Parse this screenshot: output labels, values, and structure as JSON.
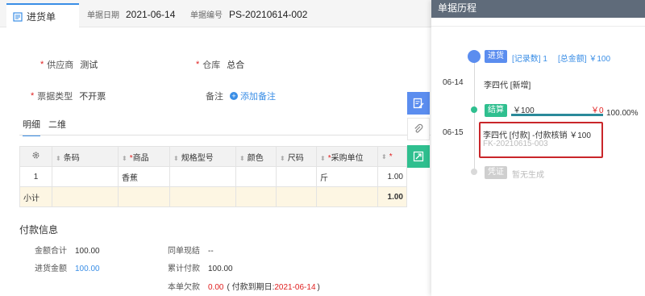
{
  "header": {
    "tab_label": "进货单",
    "date_label": "单据日期",
    "date_value": "2021-06-14",
    "number_label": "单据编号",
    "number_value": "PS-20210614-002"
  },
  "form": {
    "supplier_label": "供应商",
    "supplier_value": "测试",
    "warehouse_label": "仓库",
    "warehouse_value": "总合",
    "invoice_type_label": "票据类型",
    "invoice_type_value": "不开票",
    "note_label": "备注",
    "add_note_label": "添加备注"
  },
  "subtabs": [
    "明细",
    "二维"
  ],
  "table": {
    "headers": [
      "条码",
      "商品",
      "规格型号",
      "颜色",
      "尺码",
      "采购单位"
    ],
    "row": {
      "index": "1",
      "product": "香蕉",
      "unit": "斤",
      "qty": "1.00"
    },
    "subtotal_label": "小计",
    "subtotal_value": "1.00"
  },
  "payment": {
    "title": "付款信息",
    "total_label": "金额合计",
    "total_value": "100.00",
    "purchase_label": "进货金额",
    "purchase_value": "100.00",
    "settle_label": "同单现结",
    "settle_value": "--",
    "paid_label": "累计付款",
    "paid_value": "100.00",
    "owed_label": "本单欠款",
    "owed_value": "0.00",
    "due_open": "( 付款到期日:",
    "due_date": "2021-06-14",
    "due_close": ")"
  },
  "history": {
    "title": "单据历程",
    "tag_purchase": "进货",
    "record_count": "[记录数] 1",
    "total_amount": "[总金额] ￥100",
    "date1": "06-14",
    "entry1": "李四代 [新增]",
    "tag_settle": "结算",
    "settle_amount": "￥100",
    "settle_remaining": "￥0",
    "settle_percent": "100.00%",
    "date2": "06-15",
    "entry2": "李四代 [付款] -付款核销 ￥100",
    "entry2_ref": "FK-20210615-003",
    "tag_voucher": "凭证",
    "voucher_status": "暂无生成"
  },
  "colors": {
    "accent": "#3a8ee6",
    "settle_green": "#2fbf8f",
    "highlight_red": "#c9262a"
  }
}
